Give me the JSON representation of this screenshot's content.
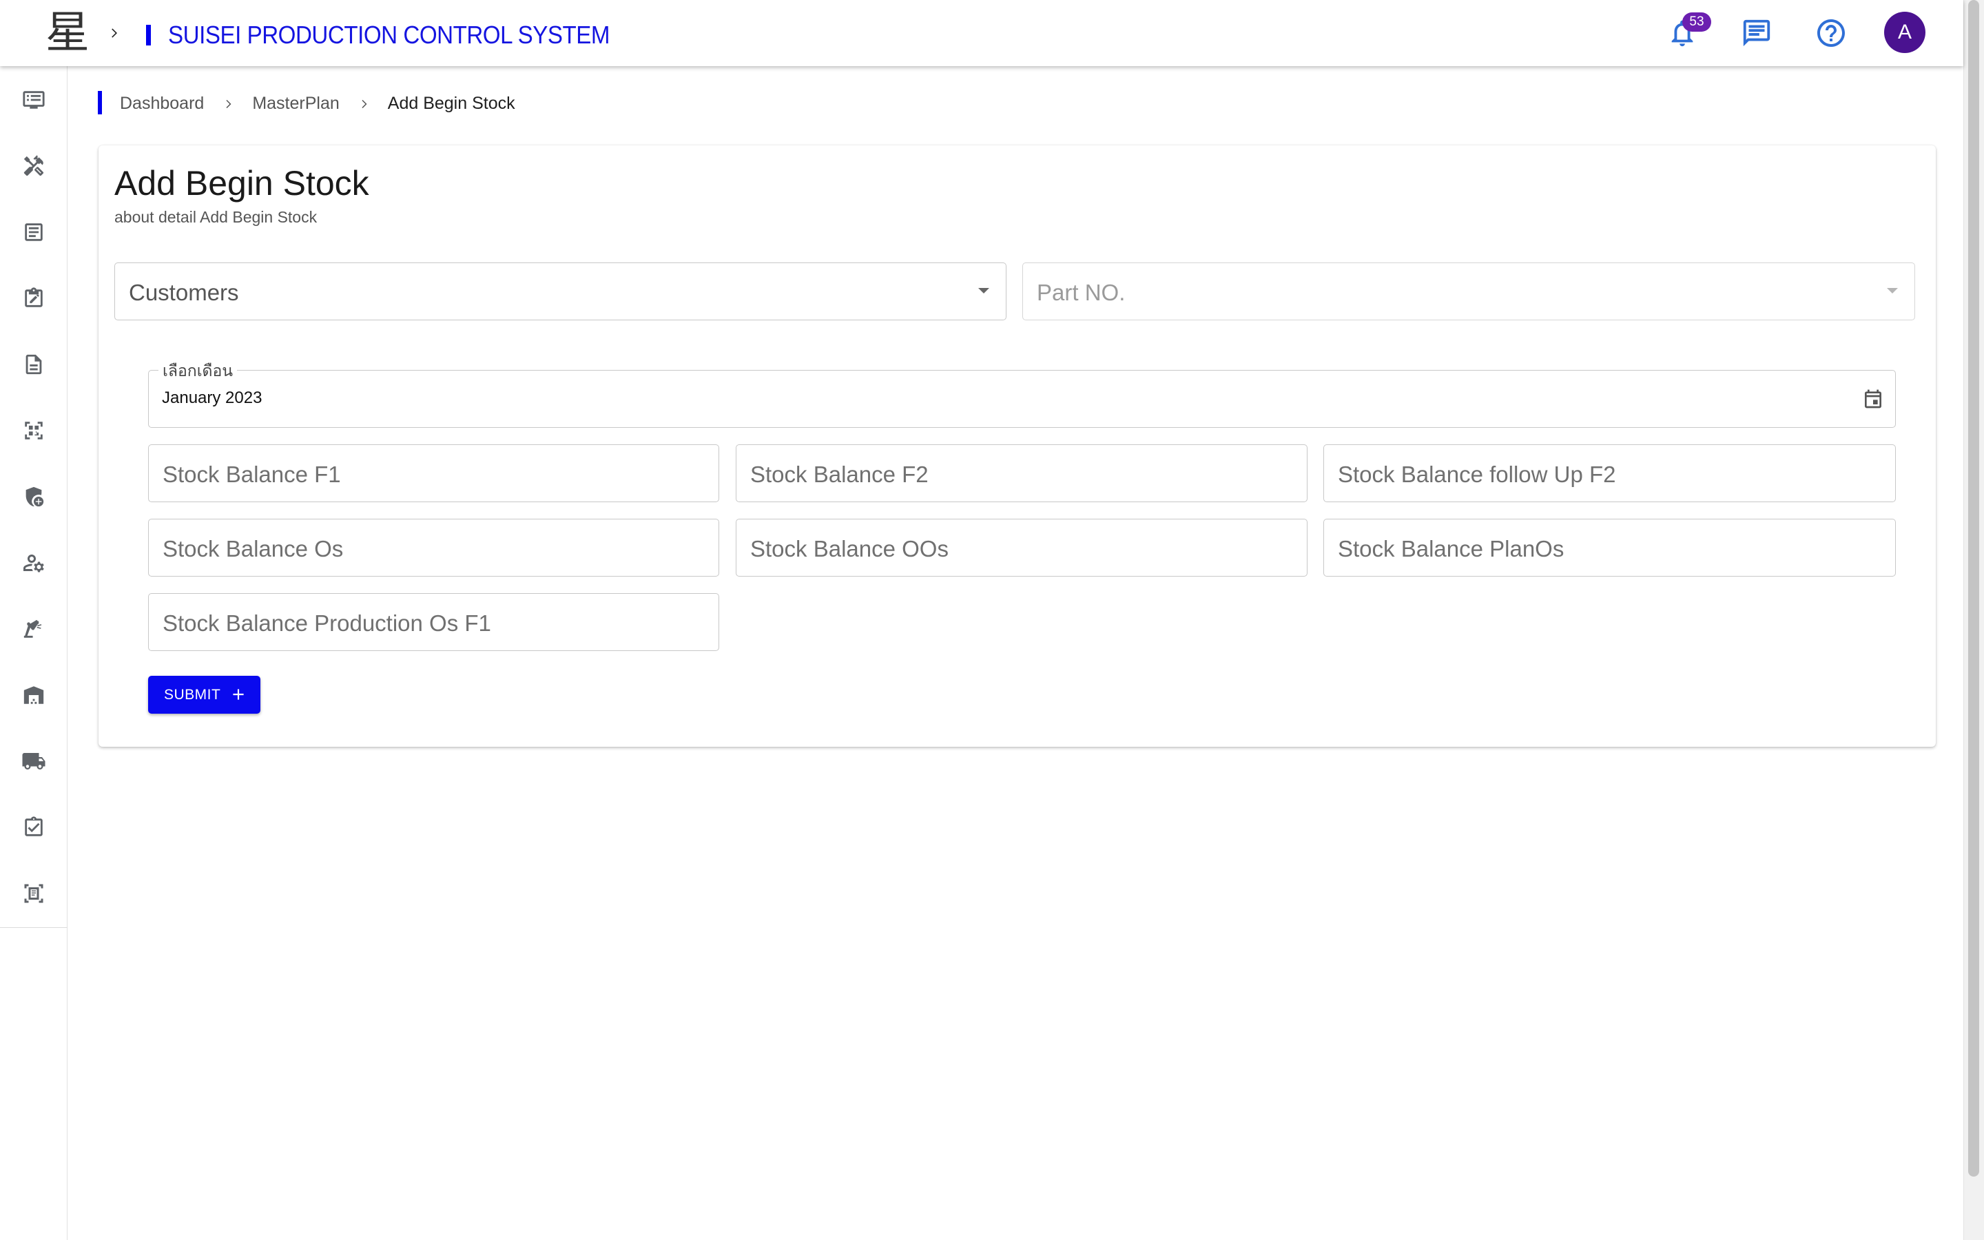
{
  "app": {
    "title": "SUISEI PRODUCTION CONTROL SYSTEM",
    "logo_glyph": "星",
    "notification_count": "53",
    "avatar_initial": "A",
    "accent_color": "#0000ee",
    "badge_color": "#6b1fb0",
    "avatar_color": "#4a1290"
  },
  "topbar_icons": [
    "notifications-bell-icon",
    "chat-message-icon",
    "help-circle-icon"
  ],
  "sidebar": {
    "items": [
      {
        "icon": "dashboard-list-icon"
      },
      {
        "icon": "tools-icon"
      },
      {
        "icon": "article-icon"
      },
      {
        "icon": "clipboard-edit-icon"
      },
      {
        "icon": "document-icon"
      },
      {
        "icon": "qr-scan-icon"
      },
      {
        "icon": "security-shield-add-icon"
      },
      {
        "icon": "people-settings-icon"
      },
      {
        "icon": "precision-robot-arm-icon"
      },
      {
        "icon": "warehouse-icon"
      },
      {
        "icon": "delivery-truck-icon"
      },
      {
        "icon": "checklist-icon"
      },
      {
        "icon": "receipt-scan-icon"
      }
    ]
  },
  "breadcrumb": {
    "items": [
      "Dashboard",
      "MasterPlan"
    ],
    "current": "Add Begin Stock"
  },
  "page": {
    "title": "Add Begin Stock",
    "subtitle": "about detail Add Begin Stock"
  },
  "form": {
    "customers_select": "Customers",
    "part_no_select": "Part NO.",
    "month_label": "เลือกเดือน",
    "month_value": "January 2023",
    "fields": [
      "Stock Balance F1",
      "Stock Balance F2",
      "Stock Balance follow Up F2",
      "Stock Balance Os",
      "Stock Balance OOs",
      "Stock Balance PlanOs",
      "Stock Balance Production Os F1"
    ],
    "submit_label": "SUBMIT"
  }
}
